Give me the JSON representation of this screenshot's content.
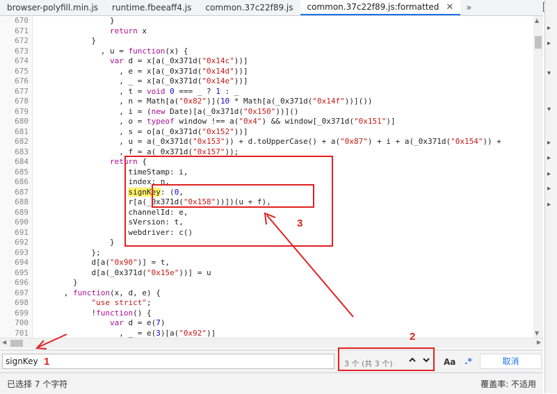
{
  "tabs": [
    {
      "label": "browser-polyfill.min.js",
      "active": false
    },
    {
      "label": "runtime.fbeeaff4.js",
      "active": false
    },
    {
      "label": "common.37c22f89.js",
      "active": false
    },
    {
      "label": "common.37c22f89.js:formatted",
      "active": true
    }
  ],
  "tab_more_label": "»",
  "code": {
    "first_line": 670,
    "lines": [
      "                }",
      "                return x",
      "            }",
      "              , u = function(x) {",
      "                var d = x[a(_0x371d(\"0x14c\"))]",
      "                  , e = x[a(_0x371d(\"0x14d\"))]",
      "                  , _ = x[a(_0x371d(\"0x14e\"))]",
      "                  , t = void 0 === _ ? 1 : _",
      "                  , n = Math[a(\"0x82\")](10 * Math[a(_0x371d(\"0x14f\"))]())",
      "                  , i = (new Date)[a(_0x371d(\"0x150\"))]()",
      "                  , o = typeof window !== a(\"0x4\") && window[_0x371d(\"0x151\")]",
      "                  , s = o[a(_0x371d(\"0x152\"))]",
      "                  , u = a(_0x371d(\"0x153\")) + d.toUpperCase() + a(\"0x87\") + i + a(_0x371d(\"0x154\")) +",
      "                  , f = a(_0x371d(\"0x157\"));",
      "                return {",
      "                    timeStamp: i,",
      "                    index: n,",
      "                    signKey: (0,",
      "                    r[a(_0x371d(\"0x158\"))])(u + f),",
      "                    channelId: e,",
      "                    sVersion: t,",
      "                    webdriver: c()",
      "                }",
      "            };",
      "            d[a(\"0x90\")] = t,",
      "            d[a(_0x371d(\"0x15e\"))] = u",
      "        }",
      "      , function(x, d, e) {",
      "            \"use strict\";",
      "            !function() {",
      "                var d = e(7)",
      "                  , _ = e(3)[a(\"0x92\")]"
    ]
  },
  "search": {
    "value": "signKey",
    "match_count": "3 个 (共 3 个)",
    "prev_icon": "chevron-up-icon",
    "next_icon": "chevron-down-icon",
    "match_case_label": "Aa",
    "regex_label": ".*",
    "cancel_label": "取消"
  },
  "status": {
    "selection": "已选择 7 个字符",
    "coverage": "覆盖率: 不适用"
  },
  "annotations": {
    "labels": [
      "1",
      "2",
      "3"
    ],
    "color": "#e02020"
  }
}
